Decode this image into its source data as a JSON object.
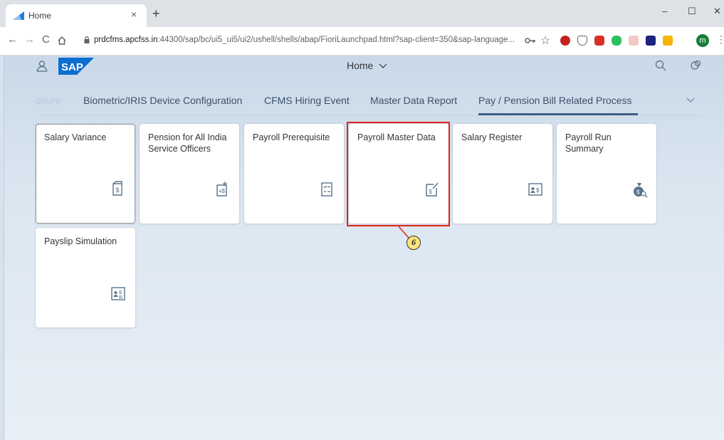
{
  "browser": {
    "tab_title": "Home",
    "tab_close": "×",
    "new_tab": "+",
    "window_controls": {
      "minimize": "–",
      "maximize": "☐",
      "close": "✕"
    },
    "url_host": "prdcfms.apcfss.in",
    "url_rest": ":44300/sap/bc/ui5_ui5/ui2/ushell/shells/abap/FioriLaunchpad.html?sap-client=350&sap-language...",
    "profile_initial": "m",
    "extensions": [
      "key-icon",
      "star-icon",
      "adblock-icon",
      "pocket-icon",
      "ublock-icon",
      "evernote-icon",
      "pdf-icon",
      "extension-icon",
      "drive-icon"
    ]
  },
  "shell": {
    "title": "Home",
    "title_chevron": "⌵"
  },
  "anchor_bar": {
    "items": [
      {
        "label": "diture"
      },
      {
        "label": "Biometric/IRIS Device Configuration"
      },
      {
        "label": "CFMS Hiring Event"
      },
      {
        "label": "Master Data Report"
      },
      {
        "label": "Pay / Pension Bill Related Process"
      }
    ],
    "selected": "Pay / Pension Bill Related Process"
  },
  "tiles": [
    {
      "title": "Salary Variance",
      "icon": "salary-document-icon"
    },
    {
      "title": "Pension for All India Service Officers",
      "icon": "add-payment-document-icon"
    },
    {
      "title": "Payroll Prerequisite",
      "icon": "checklist-icon"
    },
    {
      "title": "Payroll Master Data",
      "icon": "edit-salary-document-icon"
    },
    {
      "title": "Salary Register",
      "icon": "employee-salary-icon"
    },
    {
      "title": "Payroll Run Summary",
      "icon": "money-search-icon"
    },
    {
      "title": "Payslip Simulation",
      "icon": "payslip-icon"
    }
  ],
  "annotation": {
    "step_label": "6"
  },
  "colors": {
    "highlight": "#e0231e",
    "badge": "#fbe37e",
    "shell_top": "#c9d8e8",
    "shell_bottom": "#e8eff6",
    "sap_blue": "#0a6ed1"
  }
}
